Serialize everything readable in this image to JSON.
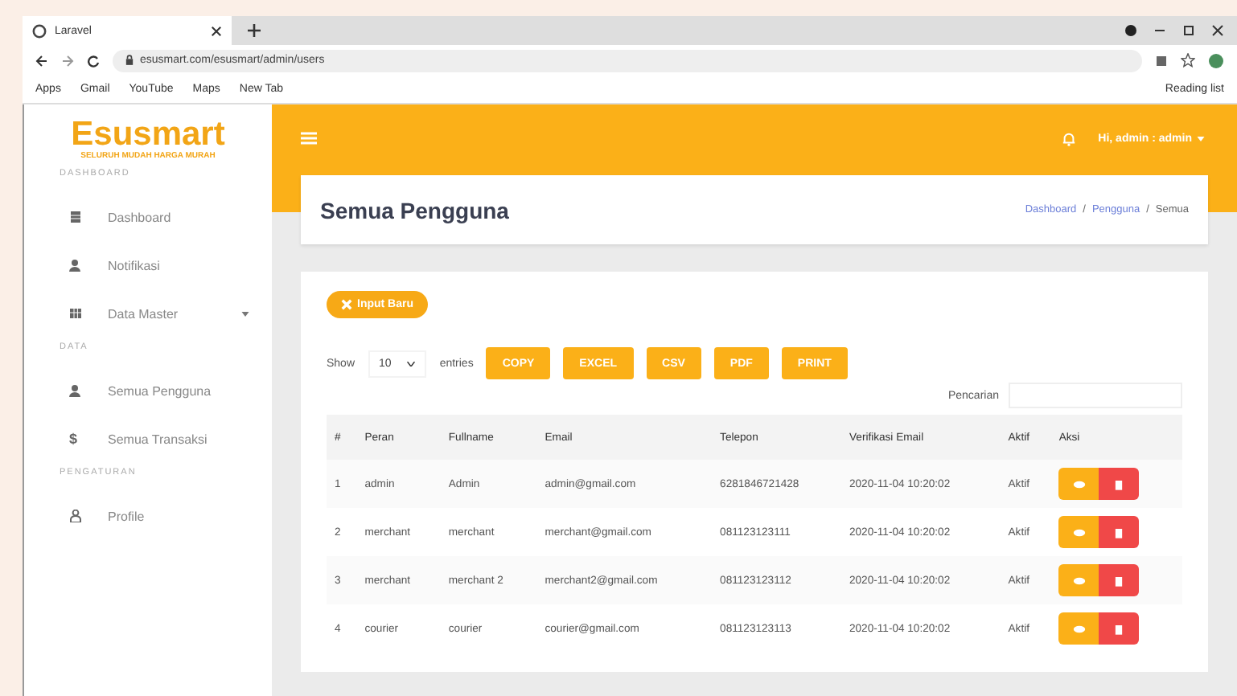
{
  "browser": {
    "tab_title": "Laravel",
    "url": "esusmart.com/esusmart/admin/users",
    "bookmarks": [
      "Apps",
      "Gmail",
      "YouTube",
      "Maps",
      "New Tab"
    ],
    "reading_list": "Reading list"
  },
  "brand": {
    "name": "Esusmart",
    "tagline": "SELURUH MUDAH HARGA MURAH"
  },
  "sidebar": {
    "sections": [
      {
        "heading": "DASHBOARD",
        "items": [
          {
            "label": "Dashboard",
            "kind": "grid"
          },
          {
            "label": "Notifikasi",
            "kind": "user"
          },
          {
            "label": "Data Master",
            "kind": "table",
            "expandable": true
          }
        ]
      },
      {
        "heading": "DATA",
        "items": [
          {
            "label": "Semua Pengguna",
            "kind": "user"
          },
          {
            "label": "Semua Transaksi",
            "kind": "dollar",
            "glyph": "$"
          }
        ]
      },
      {
        "heading": "PENGATURAN",
        "items": [
          {
            "label": "Profile",
            "kind": "person"
          }
        ]
      }
    ]
  },
  "topbar": {
    "user": "Hi, admin : admin"
  },
  "page": {
    "title": "Semua Pengguna",
    "breadcrumb_separator": "/",
    "breadcrumb": [
      {
        "label": "Dashboard",
        "link": true
      },
      {
        "label": "Pengguna",
        "link": true
      },
      {
        "label": "Semua",
        "link": false
      }
    ]
  },
  "add_button": "Input Baru",
  "length": {
    "show": "Show",
    "value": "10",
    "entries": "entries"
  },
  "export_buttons": [
    "COPY",
    "EXCEL",
    "CSV",
    "PDF",
    "PRINT"
  ],
  "search": {
    "label": "Pencarian"
  },
  "table": {
    "columns": [
      "#",
      "Peran",
      "Fullname",
      "Email",
      "Telepon",
      "Verifikasi Email",
      "Aktif",
      "Aksi"
    ],
    "rows": [
      [
        "1",
        "admin",
        "Admin",
        "admin@gmail.com",
        "6281846721428",
        "2020-11-04 10:20:02",
        "Aktif"
      ],
      [
        "2",
        "merchant",
        "merchant",
        "merchant@gmail.com",
        "081123123111",
        "2020-11-04 10:20:02",
        "Aktif"
      ],
      [
        "3",
        "merchant",
        "merchant 2",
        "merchant2@gmail.com",
        "081123123112",
        "2020-11-04 10:20:02",
        "Aktif"
      ],
      [
        "4",
        "courier",
        "courier",
        "courier@gmail.com",
        "081123123113",
        "2020-11-04 10:20:02",
        "Aktif"
      ]
    ]
  }
}
